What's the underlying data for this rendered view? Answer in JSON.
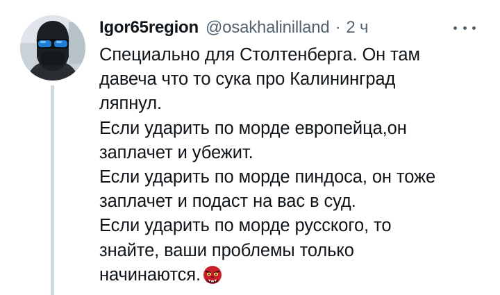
{
  "author": {
    "display_name": "Igor65region",
    "handle": "@osakhalinilland",
    "separator": "·",
    "time": "2 ч",
    "avatar_icon": "avatar-photo"
  },
  "actions": {
    "more_icon": "more-horizontal-icon"
  },
  "tweet": {
    "lines": [
      "Специально для Столтенберга. Он там",
      "давеча что то сука про Калининград",
      "ляпнул.",
      "Если ударить по морде европейца,он",
      "заплачет и убежит.",
      "Если ударить по морде пиндоса, он тоже",
      "заплачет и подаст на вас в суд.",
      "Если ударить по морде русского, то",
      "знайте, ваши проблемы только",
      "начинаются."
    ],
    "trailing_emoji": "ogre-emoji"
  },
  "colors": {
    "text": "#0f1419",
    "secondary": "#536471",
    "thread_line": "#cfd9de"
  }
}
